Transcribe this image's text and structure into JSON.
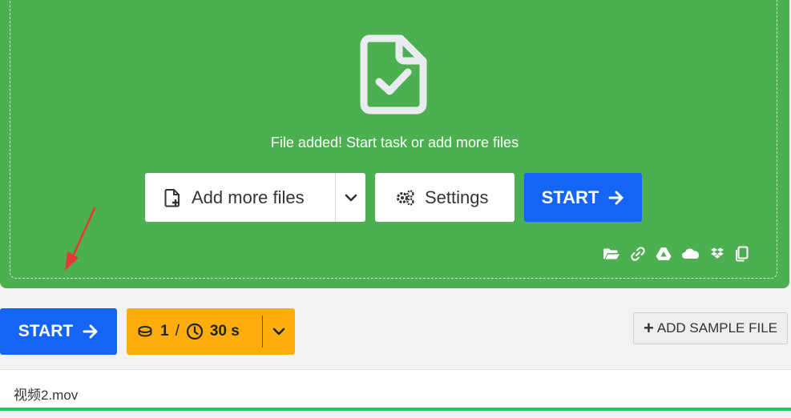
{
  "dropzone": {
    "status_text": "File added! Start task or add more files",
    "icon": "file-check-icon",
    "add_more_label": "Add more files",
    "settings_label": "Settings",
    "start_label": "START",
    "sources": [
      "folder-icon",
      "link-icon",
      "google-drive-icon",
      "onedrive-icon",
      "dropbox-icon",
      "clipboard-icon"
    ]
  },
  "toolbar": {
    "start_label": "START",
    "credits": "1",
    "separator": "/",
    "time": "30 s",
    "add_sample_label": "ADD SAMPLE FILE"
  },
  "file": {
    "name": "视频2.mov",
    "progress": 1.0
  },
  "colors": {
    "dropzone": "#4caf50",
    "primary": "#1565f5",
    "cost": "#ffad0a",
    "progress": "#1ec55b",
    "annotation_arrow": "#e53935"
  }
}
